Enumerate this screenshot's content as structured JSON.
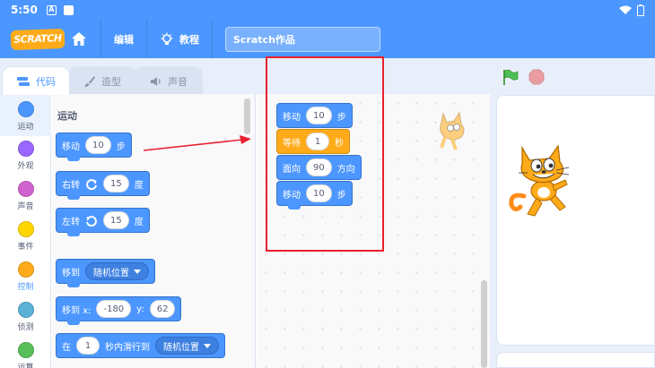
{
  "status_bar": {
    "time": "5:50",
    "app_icon": "A"
  },
  "menubar": {
    "logo_text": "SCRATCH",
    "edit_label": "编辑",
    "tutorials_label": "教程",
    "project_title": "Scratch作品"
  },
  "tabs": [
    {
      "label": "代码",
      "active": true
    },
    {
      "label": "造型",
      "active": false
    },
    {
      "label": "声音",
      "active": false
    }
  ],
  "categories": [
    {
      "label": "运动",
      "color": "#4c97ff"
    },
    {
      "label": "外观",
      "color": "#9966ff"
    },
    {
      "label": "声音",
      "color": "#cf63cf"
    },
    {
      "label": "事件",
      "color": "#ffd500"
    },
    {
      "label": "控制",
      "color": "#ffab19"
    },
    {
      "label": "侦测",
      "color": "#5cb1d6"
    },
    {
      "label": "运算",
      "color": "#59c059"
    }
  ],
  "palette": {
    "section_title": "运动",
    "move": {
      "label": "移动",
      "value": "10",
      "unit": "步"
    },
    "turn_right": {
      "label": "右转",
      "value": "15",
      "unit": "度"
    },
    "turn_left": {
      "label": "左转",
      "value": "15",
      "unit": "度"
    },
    "goto": {
      "label": "移到",
      "option": "随机位置"
    },
    "goto_xy": {
      "label": "移到 x:",
      "x": "-180",
      "y_label": "y:",
      "y": "62"
    },
    "glide": {
      "label": "在",
      "secs": "1",
      "middle": "秒内滑行到",
      "option": "随机位置"
    }
  },
  "script": {
    "move1": {
      "label": "移动",
      "value": "10",
      "unit": "步"
    },
    "wait": {
      "label": "等待",
      "value": "1",
      "unit": "秒"
    },
    "point": {
      "label": "面向",
      "value": "90",
      "unit": "方向"
    },
    "move2": {
      "label": "移动",
      "value": "10",
      "unit": "步"
    }
  },
  "colors": {
    "motion": "#4c97ff",
    "control": "#ffab19",
    "accent": "#4c97ff",
    "highlight_box": "#e8202e",
    "cat_orange": "#ff8c1a"
  }
}
